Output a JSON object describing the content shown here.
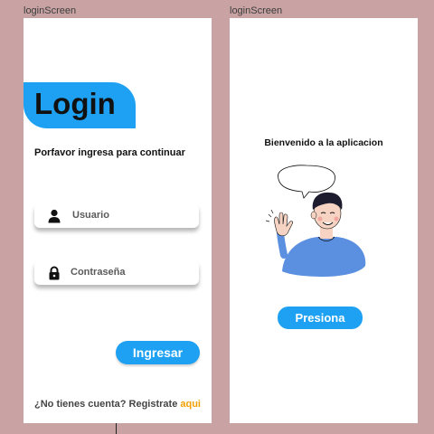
{
  "frames": {
    "left_label": "loginScreen",
    "right_label": "loginScreen"
  },
  "login": {
    "title": "Login",
    "subtitle": "Porfavor ingresa para continuar",
    "username_placeholder": "Usuario",
    "password_placeholder": "Contraseña",
    "submit_label": "Ingresar",
    "footer_text": "¿No tienes cuenta? Registrate ",
    "footer_link": "aqui"
  },
  "welcome": {
    "title": "Bienvenido a la aplicacion",
    "button_label": "Presiona"
  },
  "icons": {
    "username": "user-icon",
    "password": "lock-icon"
  },
  "colors": {
    "background": "#c9a3a3",
    "accent": "#1ea1f2",
    "link": "#f0a000",
    "shirt": "#5b8fe0"
  }
}
